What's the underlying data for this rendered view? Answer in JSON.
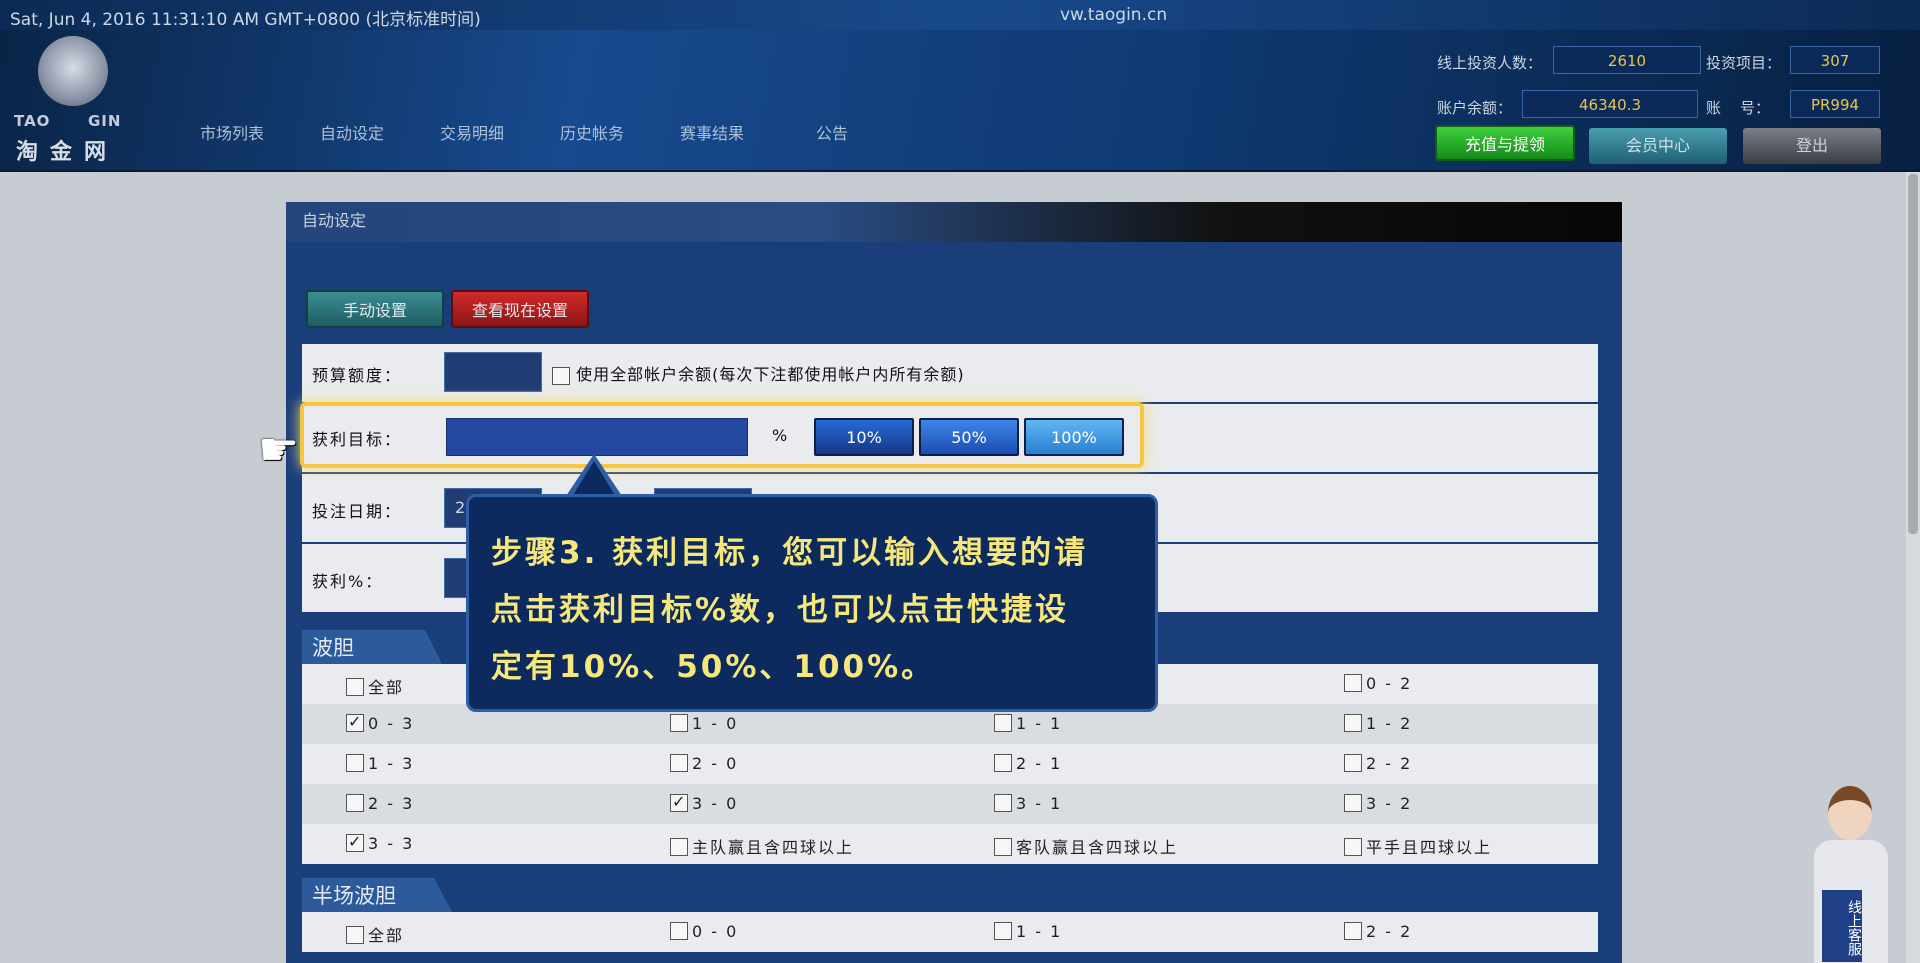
{
  "topbar": {
    "datetime": "Sat, Jun 4, 2016 11:31:10 AM GMT+0800 (北京标准时间)",
    "site": "vw.taogin.cn"
  },
  "logo": {
    "en_left": "TAO",
    "en_right": "GIN",
    "zh": "淘金网"
  },
  "nav": [
    "市场列表",
    "自动设定",
    "交易明细",
    "历史帐务",
    "赛事结果",
    "公告"
  ],
  "stats": {
    "online_label": "线上投资人数：",
    "online_value": "2610",
    "projects_label": "投资项目：",
    "projects_value": "307",
    "balance_label": "账户余额：",
    "balance_value": "46340.3",
    "account_label_1": "账",
    "account_label_2": "号：",
    "account_value": "PR994"
  },
  "header_buttons": {
    "deposit": "充值与提领",
    "member": "会员中心",
    "logout": "登出"
  },
  "panel": {
    "title": "自动设定",
    "manual_btn": "手动设置",
    "view_btn": "查看现在设置",
    "budget_label": "预算额度：",
    "use_all_label": "使用全部帐户余额(每次下注都使用帐户内所有余额)",
    "target_label": "获利目标：",
    "percent_sign": "%",
    "quick": [
      "10%",
      "50%",
      "100%"
    ],
    "date_label": "投注日期：",
    "date_value_partial": "2",
    "profit_label": "获利%："
  },
  "tooltip": {
    "line1": "步骤3. 获利目标，您可以输入想要的请",
    "line2": "点击获利目标%数，也可以点击快捷设",
    "line3": "定有10%、50%、100%。"
  },
  "section_bodan": {
    "title": "波胆",
    "rows": [
      [
        {
          "label": "全部",
          "checked": false
        },
        {
          "label": "",
          "checked": false
        },
        {
          "label": "",
          "checked": false
        },
        {
          "label": "0 - 2",
          "checked": false
        }
      ],
      [
        {
          "label": "0 - 3",
          "checked": true
        },
        {
          "label": "1 - 0",
          "checked": false
        },
        {
          "label": "1 - 1",
          "checked": false
        },
        {
          "label": "1 - 2",
          "checked": false
        }
      ],
      [
        {
          "label": "1 - 3",
          "checked": false
        },
        {
          "label": "2 - 0",
          "checked": false
        },
        {
          "label": "2 - 1",
          "checked": false
        },
        {
          "label": "2 - 2",
          "checked": false
        }
      ],
      [
        {
          "label": "2 - 3",
          "checked": false
        },
        {
          "label": "3 - 0",
          "checked": true
        },
        {
          "label": "3 - 1",
          "checked": false
        },
        {
          "label": "3 - 2",
          "checked": false
        }
      ],
      [
        {
          "label": "3 - 3",
          "checked": true
        },
        {
          "label": "主队赢且含四球以上",
          "checked": false
        },
        {
          "label": "客队赢且含四球以上",
          "checked": false
        },
        {
          "label": "平手且四球以上",
          "checked": false
        }
      ]
    ]
  },
  "section_half": {
    "title": "半场波胆",
    "rows": [
      [
        {
          "label": "全部",
          "checked": false
        },
        {
          "label": "0 - 0",
          "checked": false
        },
        {
          "label": "1 - 1",
          "checked": false
        },
        {
          "label": "2 - 2",
          "checked": false
        }
      ]
    ]
  },
  "agent": {
    "badge": "线上客服"
  }
}
